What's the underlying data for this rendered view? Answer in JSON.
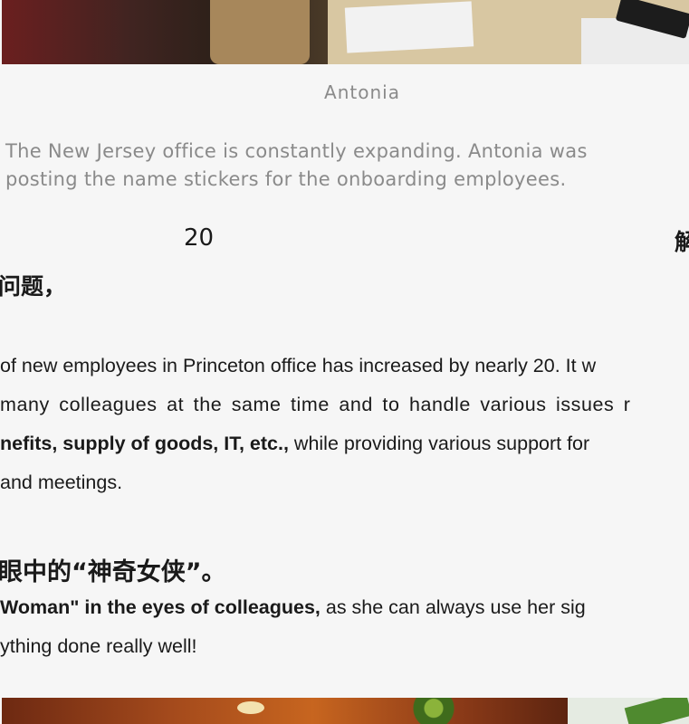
{
  "caption": {
    "name": "Antonia",
    "description_line1": "The New Jersey office is constantly expanding. Antonia was",
    "description_line2": "posting the name stickers for the onboarding employees."
  },
  "chinese": {
    "number": "20",
    "right_char": "解",
    "question_line": "问题，",
    "hero_line": "眼中的“神奇女侠”。"
  },
  "paragraph1": {
    "line1": "of new employees in Princeton office has increased by nearly 20. It w",
    "line2": "many colleagues at the same time and to handle various issues r",
    "line3_bold": "nefits, supply of goods, IT, etc.,",
    "line3_rest": " while providing various support for",
    "line4": "and meetings."
  },
  "paragraph2": {
    "line1_bold": "Woman\" in the eyes of colleagues,",
    "line1_rest": " as she can always use her sig",
    "line2": "ything done really well!"
  }
}
